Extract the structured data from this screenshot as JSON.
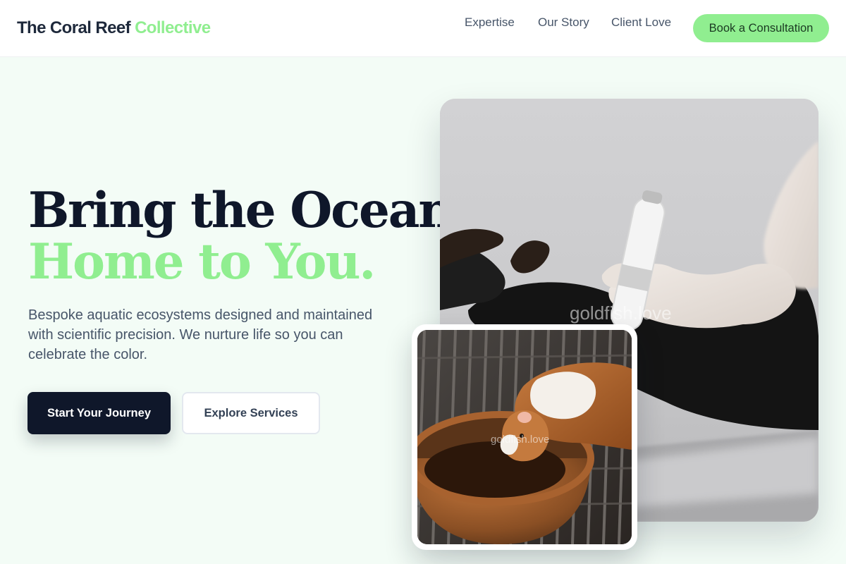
{
  "header": {
    "logo_main": "The Coral Reef",
    "logo_accent": "Collective",
    "nav": [
      {
        "label": "Expertise"
      },
      {
        "label": "Our Story"
      },
      {
        "label": "Client Love"
      }
    ],
    "cta_label": "Book a Consultation"
  },
  "hero": {
    "headline_line1": "Bring the Ocean",
    "headline_line2": "Home to You.",
    "description": "Bespoke aquatic ecosystems designed and maintained with scientific precision. We nurture life so you can celebrate the color.",
    "primary_button": "Start Your Journey",
    "secondary_button": "Explore Services"
  },
  "images": {
    "large_watermark": "goldfish.love",
    "small_watermark": "goldfish.love"
  },
  "colors": {
    "accent": "#90ee90",
    "dark": "#0f172a",
    "page_background": "#f3fcf6",
    "body_text": "#475569"
  }
}
